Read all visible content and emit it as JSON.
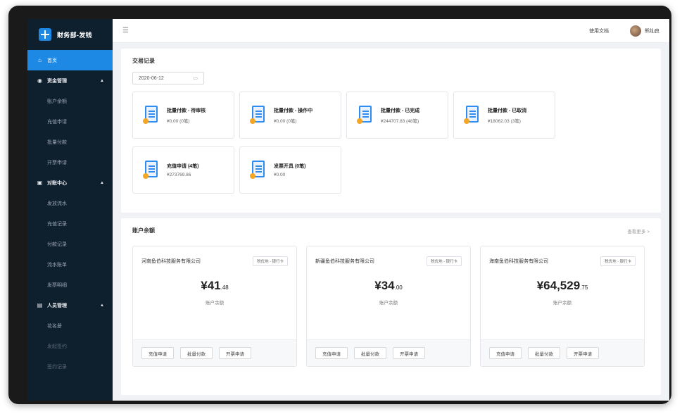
{
  "brand": {
    "title": "财务部-发钱"
  },
  "sidebar": {
    "home": "首页",
    "groups": [
      {
        "label": "资金管理",
        "items": [
          "账户余额",
          "充值申请",
          "批量付款",
          "开票申请"
        ]
      },
      {
        "label": "对账中心",
        "items": [
          "发放流水",
          "充值记录",
          "付款记录",
          "流水账单",
          "发票明细"
        ]
      },
      {
        "label": "人员管理",
        "items": [
          "花名册",
          "发起签约",
          "签约记录"
        ]
      }
    ]
  },
  "topbar": {
    "doc_link": "使用文档",
    "user_name": "熊灿良"
  },
  "transactions": {
    "title": "交易记录",
    "date": "2020-06-12",
    "cards": [
      {
        "name": "批量付款 - 待审核",
        "amount": "¥0.00 (0笔)"
      },
      {
        "name": "批量付款 - 操作中",
        "amount": "¥0.00 (0笔)"
      },
      {
        "name": "批量付款 - 已完成",
        "amount": "¥244707.83 (48笔)"
      },
      {
        "name": "批量付款 - 已取消",
        "amount": "¥18062.03 (3笔)"
      },
      {
        "name": "充值申请 (4笔)",
        "amount": "¥273769.86"
      },
      {
        "name": "发票开具 (0笔)",
        "amount": "¥0.00"
      }
    ]
  },
  "balances": {
    "title": "账户余额",
    "more": "查看更多 >",
    "accounts": [
      {
        "name": "河南鱼伯科技服务有限公司",
        "tag": "税优地 - 银行卡",
        "amount_int": "¥41",
        "amount_dec": ".48",
        "label": "账户余额",
        "actions": [
          "充值申请",
          "批量付款",
          "开票申请"
        ]
      },
      {
        "name": "新疆鱼伯科技服务有限公司",
        "tag": "税优地 - 银行卡",
        "amount_int": "¥34",
        "amount_dec": ".00",
        "label": "账户余额",
        "actions": [
          "充值申请",
          "批量付款",
          "开票申请"
        ]
      },
      {
        "name": "海南鱼伯科技服务有限公司",
        "tag": "税优地 - 银行卡",
        "amount_int": "¥64,529",
        "amount_dec": ".75",
        "label": "账户余额",
        "actions": [
          "充值申请",
          "批量付款",
          "开票申请"
        ]
      }
    ]
  },
  "colors": {
    "sidebar_bg": "#0e1f2e",
    "accent": "#1e88e5",
    "icon_orange": "#f5a623"
  }
}
